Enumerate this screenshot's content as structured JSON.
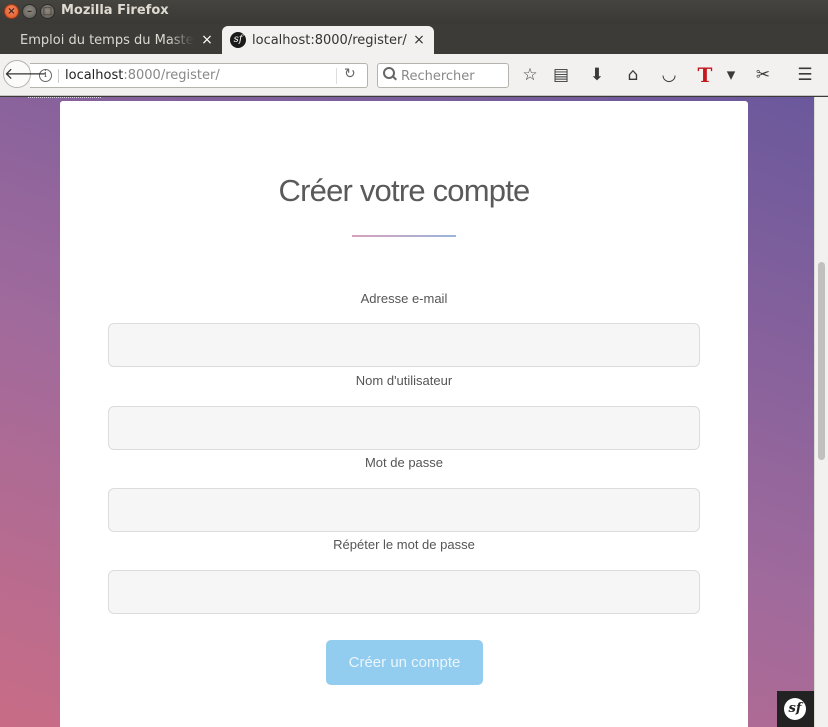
{
  "window": {
    "title": "Mozilla Firefox",
    "buttons": {
      "close": "×",
      "minimize": "–",
      "maximize": "□"
    }
  },
  "tabs": [
    {
      "label": "Emploi du temps du Master GI",
      "active": false,
      "close": "×"
    },
    {
      "label": "localhost:8000/register/",
      "active": true,
      "close": "×",
      "favicon": "sf"
    }
  ],
  "new_tab": "+",
  "navbar": {
    "back": "🡐",
    "url_host": "localhost",
    "url_rest": ":8000/register/",
    "reload": "↻",
    "search_placeholder": "Rechercher",
    "tools": {
      "bookmark": "☆",
      "reading_list": "▤",
      "download": "⬇",
      "home": "⌂",
      "pocket": "◡",
      "brand_t": "T",
      "dropdown": "▾",
      "screenshot": "✂",
      "menu": "☰"
    }
  },
  "page": {
    "title": "Créer votre compte",
    "fields": [
      {
        "label": "Adresse e-mail",
        "value": ""
      },
      {
        "label": "Nom d'utilisateur",
        "value": ""
      },
      {
        "label": "Mot de passe",
        "value": ""
      },
      {
        "label": "Répéter le mot de passe",
        "value": ""
      }
    ],
    "submit_label": "Créer un compte"
  },
  "symfony_toolbar": {
    "logo": "sf"
  },
  "colors": {
    "background_start": "#c86c86",
    "background_end": "#6a589c",
    "submit_button": "#92ccee",
    "input_background": "#f6f6f6"
  }
}
